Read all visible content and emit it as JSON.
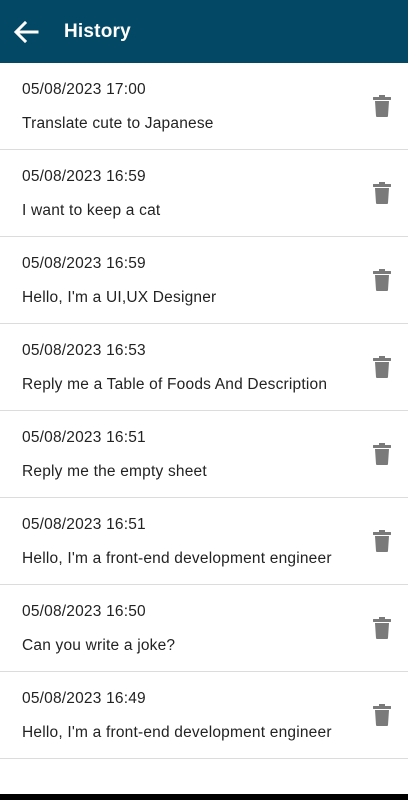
{
  "header": {
    "title": "History",
    "background": "#034864",
    "back_icon": "arrow-left-icon"
  },
  "history": {
    "delete_icon": "trash-icon",
    "items": [
      {
        "timestamp": "05/08/2023 17:00",
        "message": "Translate cute to Japanese"
      },
      {
        "timestamp": "05/08/2023 16:59",
        "message": "I want to keep a cat"
      },
      {
        "timestamp": "05/08/2023 16:59",
        "message": "Hello, I'm a UI,UX Designer"
      },
      {
        "timestamp": "05/08/2023 16:53",
        "message": "Reply me a Table of Foods And Description"
      },
      {
        "timestamp": "05/08/2023 16:51",
        "message": "Reply me the empty sheet"
      },
      {
        "timestamp": "05/08/2023 16:51",
        "message": "Hello, I'm a front-end development engineer"
      },
      {
        "timestamp": "05/08/2023 16:50",
        "message": "Can you write a joke?"
      },
      {
        "timestamp": "05/08/2023 16:49",
        "message": "Hello, I'm a front-end development engineer"
      }
    ]
  }
}
